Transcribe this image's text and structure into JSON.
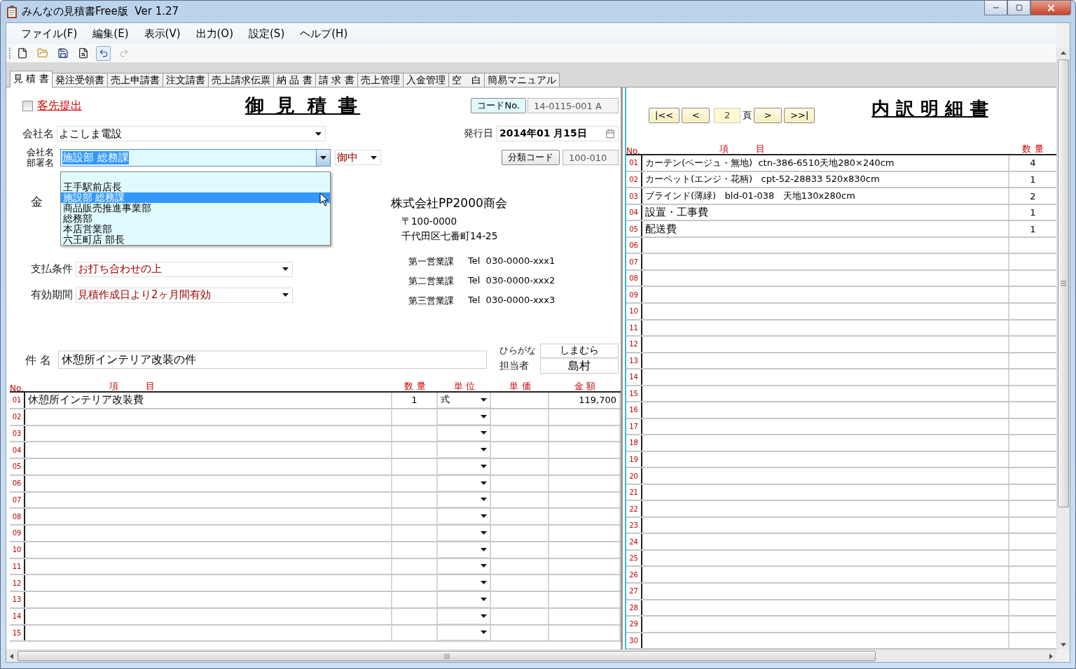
{
  "window": {
    "title": "みんなの見積書Free版  Ver 1.27"
  },
  "menu": [
    "ファイル(F)",
    "編集(E)",
    "表示(V)",
    "出力(O)",
    "設定(S)",
    "ヘルプ(H)"
  ],
  "toolbar": [
    {
      "kind": "new",
      "disabled": false,
      "highlighted": false
    },
    {
      "kind": "open",
      "disabled": false,
      "highlighted": false
    },
    {
      "kind": "save",
      "disabled": false,
      "highlighted": false
    },
    {
      "kind": "preview",
      "disabled": false,
      "highlighted": false
    },
    {
      "kind": "undo",
      "disabled": false,
      "highlighted": true
    },
    {
      "kind": "redo",
      "disabled": true,
      "highlighted": false
    }
  ],
  "tabs": [
    {
      "label": "見 積 書",
      "selected": true
    },
    {
      "label": "発注受領書",
      "selected": false
    },
    {
      "label": "売上申請書",
      "selected": false
    },
    {
      "label": "注文請書",
      "selected": false
    },
    {
      "label": "売上請求伝票",
      "selected": false
    },
    {
      "label": "納 品 書",
      "selected": false
    },
    {
      "label": "請 求 書",
      "selected": false
    },
    {
      "label": "売上管理",
      "selected": false
    },
    {
      "label": "入金管理",
      "selected": false
    },
    {
      "label": "空　白",
      "selected": false
    },
    {
      "label": "簡易マニュアル",
      "selected": false
    }
  ],
  "estimate": {
    "client_submit": {
      "label": "客先提出",
      "checked": false
    },
    "title": "御 見 積 書",
    "code_button": "コードNo.",
    "code_value": "14-0115-001 A",
    "company_label": "会社名",
    "company_value": "よこしま電設",
    "dept_label_1": "会社名",
    "dept_label_2": "部署名",
    "dept_value": "施設部 総務課",
    "honorific": "御中",
    "dept_options": [
      {
        "label": "王手駅前店長",
        "selected": false
      },
      {
        "label": "施設部 総務課",
        "selected": true
      },
      {
        "label": "商品販売推進事業部",
        "selected": false
      },
      {
        "label": "総務部",
        "selected": false
      },
      {
        "label": "本店営業部",
        "selected": false
      },
      {
        "label": "六王町店 部長",
        "selected": false
      }
    ],
    "amount_label": "金",
    "payment_label": "支払条件",
    "payment_value": "お打ち合わせの上",
    "validity_label": "有効期間",
    "validity_value": "見積作成日より2ヶ月間有効",
    "issue_label": "発行日",
    "issue_date": "2014年01 月15日",
    "category_button": "分類コード",
    "category_value": "100-010",
    "issuer": {
      "name": "株式会社PP2000商会",
      "postal": "〒100-0000",
      "address": "千代田区七番町14-25",
      "phones": [
        {
          "dept": "第一営業課",
          "tel": "Tel  030-0000-xxx1"
        },
        {
          "dept": "第二営業課",
          "tel": "Tel  030-0000-xxx2"
        },
        {
          "dept": "第三営業課",
          "tel": "Tel  030-0000-xxx3"
        }
      ]
    },
    "subject_label": "件 名",
    "subject_value": "休憩所インテリア改装の件",
    "furigana_label": "ひらがな",
    "furigana_value": "しまむら",
    "staff_label": "担当者",
    "staff_value": "島村",
    "columns": [
      "No.",
      "項　　　目",
      "数 量",
      "単 位",
      "単 価",
      "金 額"
    ],
    "rows": [
      {
        "no": "01",
        "item": "休憩所インテリア改装費",
        "qty": "1",
        "unit": "式",
        "amount": "119,700"
      },
      {
        "no": "02"
      },
      {
        "no": "03"
      },
      {
        "no": "04"
      },
      {
        "no": "05"
      },
      {
        "no": "06"
      },
      {
        "no": "07"
      },
      {
        "no": "08"
      },
      {
        "no": "09"
      },
      {
        "no": "10"
      },
      {
        "no": "11"
      },
      {
        "no": "12"
      },
      {
        "no": "13"
      },
      {
        "no": "14"
      },
      {
        "no": "15"
      }
    ]
  },
  "breakdown": {
    "nav": [
      "|<<",
      "<",
      ">",
      ">>|"
    ],
    "page": "2",
    "page_unit": "頁",
    "title": "内 訳 明 細 書",
    "columns": [
      "No.",
      "項　　　目",
      "数 量"
    ],
    "rows": [
      {
        "no": "01",
        "item": "カーテン(ベージュ・無地)  ctn-386-6510天地280×240cm",
        "qty": "4"
      },
      {
        "no": "02",
        "item": "カーペット(エンジ・花柄)   cpt-52-28833 520x830cm",
        "qty": "1"
      },
      {
        "no": "03",
        "item": "ブラインド(薄緑)   bld-01-038   天地130x280cm",
        "qty": "2"
      },
      {
        "no": "04",
        "item": "設置・工事費",
        "qty": "1"
      },
      {
        "no": "05",
        "item": "配送費",
        "qty": "1"
      },
      {
        "no": "06"
      },
      {
        "no": "07"
      },
      {
        "no": "08"
      },
      {
        "no": "09"
      },
      {
        "no": "10"
      },
      {
        "no": "11"
      },
      {
        "no": "12"
      },
      {
        "no": "13"
      },
      {
        "no": "14"
      },
      {
        "no": "15"
      },
      {
        "no": "16"
      },
      {
        "no": "17"
      },
      {
        "no": "18"
      },
      {
        "no": "19"
      },
      {
        "no": "20"
      },
      {
        "no": "21"
      },
      {
        "no": "22"
      },
      {
        "no": "23"
      },
      {
        "no": "24"
      },
      {
        "no": "25"
      },
      {
        "no": "26"
      },
      {
        "no": "27"
      },
      {
        "no": "28"
      },
      {
        "no": "29"
      },
      {
        "no": "30"
      }
    ]
  }
}
